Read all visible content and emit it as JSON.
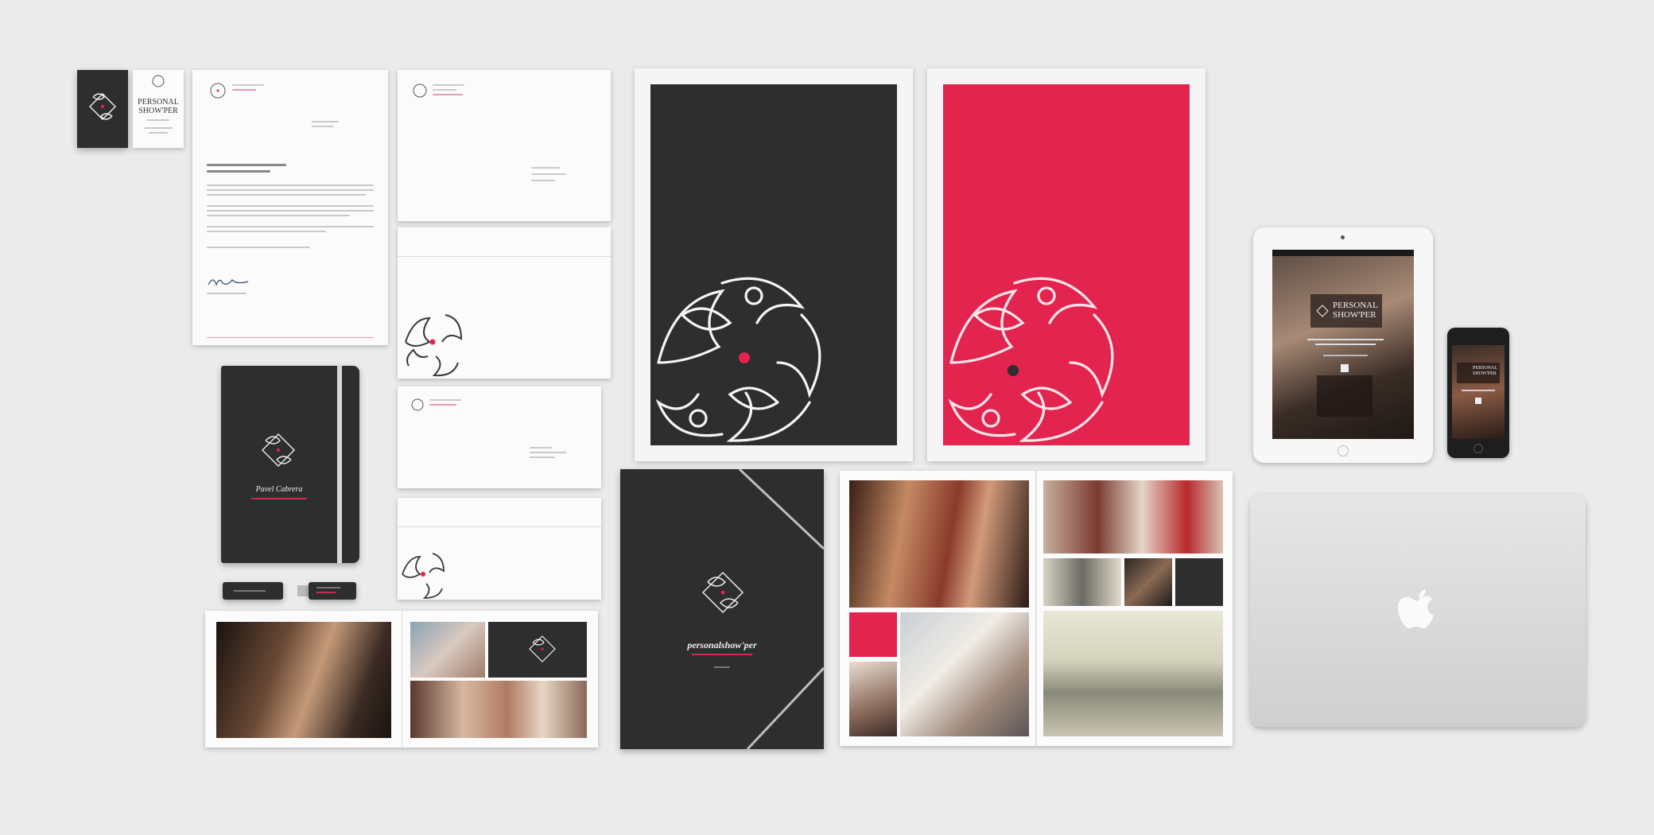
{
  "brand": {
    "name_line1": "PERSONAL",
    "name_line2": "SHOW'PER",
    "wordmark": "personalshow'per",
    "holder_name": "Pavel Cabrera"
  },
  "colors": {
    "background": "#ebebeb",
    "dark": "#2e2e2e",
    "accent": "#e3244f",
    "paper": "#fbfbfb"
  },
  "icons": {
    "monogram": "ornamental-pp-monogram-icon",
    "laptop_logo": "apple-logo-icon"
  }
}
